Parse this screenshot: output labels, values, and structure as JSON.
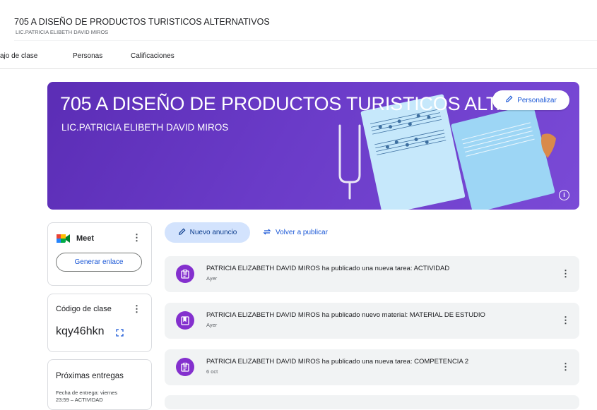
{
  "header": {
    "title": "705 A DISEÑO DE PRODUCTOS TURISTICOS ALTERNATIVOS",
    "subtitle": "LIC.PATRICIA ELIBETH DAVID MIROS"
  },
  "tabs": [
    {
      "label": "ajo de clase"
    },
    {
      "label": "Personas"
    },
    {
      "label": "Calificaciones"
    }
  ],
  "banner": {
    "title": "705 A DISEÑO DE PRODUCTOS TURISTICOS ALT...",
    "subtitle": "LIC.PATRICIA ELIBETH DAVID MIROS",
    "customize_label": "Personalizar"
  },
  "meet": {
    "title": "Meet",
    "generate_label": "Generar enlace"
  },
  "class_code": {
    "title": "Código de clase",
    "code": "kqy46hkn"
  },
  "upcoming": {
    "title": "Próximas entregas",
    "line1": "Fecha de entrega: viernes",
    "line2": "23:59 – ACTIVIDAD"
  },
  "actions": {
    "announce_label": "Nuevo anuncio",
    "republish_label": "Volver a publicar"
  },
  "stream": [
    {
      "text": "PATRICIA ELIZABETH DAVID MIROS ha publicado una nueva tarea: ACTIVIDAD",
      "date": "Ayer",
      "icon": "assignment-icon"
    },
    {
      "text": "PATRICIA ELIZABETH DAVID MIROS ha publicado nuevo material: MATERIAL DE ESTUDIO",
      "date": "Ayer",
      "icon": "material-icon"
    },
    {
      "text": "PATRICIA ELIZABETH DAVID MIROS ha publicado una nueva tarea: COMPETENCIA 2",
      "date": "6 oct",
      "icon": "assignment-icon"
    }
  ],
  "colors": {
    "banner": "#6a3bc8",
    "accent": "#1a57d6",
    "post_icon": "#8430ce",
    "announce_bg": "#d3e3fd"
  }
}
